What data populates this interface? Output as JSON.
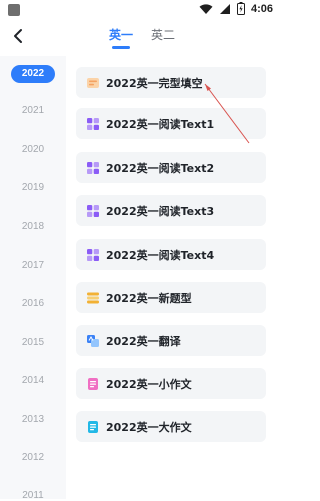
{
  "status_bar": {
    "time": "4:06",
    "icons": [
      "wifi-icon",
      "signal-icon",
      "battery-charging-icon"
    ]
  },
  "header": {
    "back_icon": "chevron-left-icon",
    "tabs": [
      {
        "label": "英一",
        "active": true
      },
      {
        "label": "英二",
        "active": false
      }
    ],
    "accent_color": "#2e7dfa"
  },
  "sidebar": {
    "years": [
      "2022",
      "2021",
      "2020",
      "2019",
      "2018",
      "2017",
      "2016",
      "2015",
      "2014",
      "2013",
      "2012",
      "2011"
    ],
    "selected": "2022"
  },
  "list": {
    "items": [
      {
        "label": "2022英一完型填空",
        "icon": "cloze-icon",
        "color": "#f4a261"
      },
      {
        "label": "2022英一阅读Text1",
        "icon": "grid-icon",
        "color": "#8b5cf6"
      },
      {
        "label": "2022英一阅读Text2",
        "icon": "grid-icon",
        "color": "#8b5cf6"
      },
      {
        "label": "2022英一阅读Text3",
        "icon": "grid-icon",
        "color": "#8b5cf6"
      },
      {
        "label": "2022英一阅读Text4",
        "icon": "grid-icon",
        "color": "#8b5cf6"
      },
      {
        "label": "2022英一新题型",
        "icon": "list-icon",
        "color": "#f2b134"
      },
      {
        "label": "2022英一翻译",
        "icon": "translate-icon",
        "color": "#3b82f6"
      },
      {
        "label": "2022英一小作文",
        "icon": "document-icon",
        "color": "#f06fc3"
      },
      {
        "label": "2022英一大作文",
        "icon": "document-icon",
        "color": "#22b8e6"
      }
    ]
  }
}
